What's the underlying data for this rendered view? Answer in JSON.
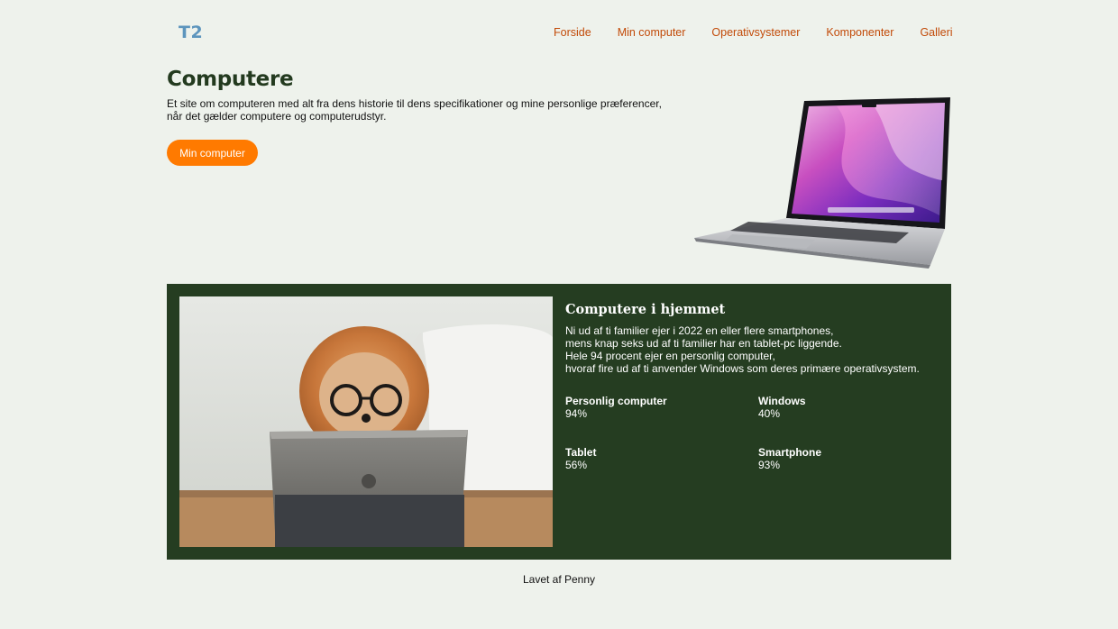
{
  "header": {
    "logo": "T2",
    "nav": [
      "Forside",
      "Min computer",
      "Operativsystemer",
      "Komponenter",
      "Galleri"
    ]
  },
  "hero": {
    "title": "Computere",
    "text": "Et site om computeren med alt fra dens historie til dens specifikationer og mine personlige præferencer, når det gælder computere og computerudstyr.",
    "button": "Min computer"
  },
  "info": {
    "title": "Computere i hjemmet",
    "lines": [
      "Ni ud af ti familier ejer i 2022 en eller flere smartphones,",
      "mens knap seks ud af ti familier har en tablet-pc liggende.",
      "Hele 94 procent ejer en personlig computer,",
      "hvoraf fire ud af ti anvender Windows som deres primære operativsystem."
    ],
    "stats": [
      {
        "label": "Personlig computer",
        "value": "94%"
      },
      {
        "label": "Windows",
        "value": "40%"
      },
      {
        "label": "Tablet",
        "value": "56%"
      },
      {
        "label": "Smartphone",
        "value": "93%"
      }
    ]
  },
  "footer": {
    "text": "Lavet af Penny"
  },
  "colors": {
    "background": "#eef2ec",
    "accent": "#ff7a00",
    "nav_link": "#c24a08",
    "panel": "#253d21",
    "heading": "#233a1f",
    "logo": "#5d95bd"
  }
}
